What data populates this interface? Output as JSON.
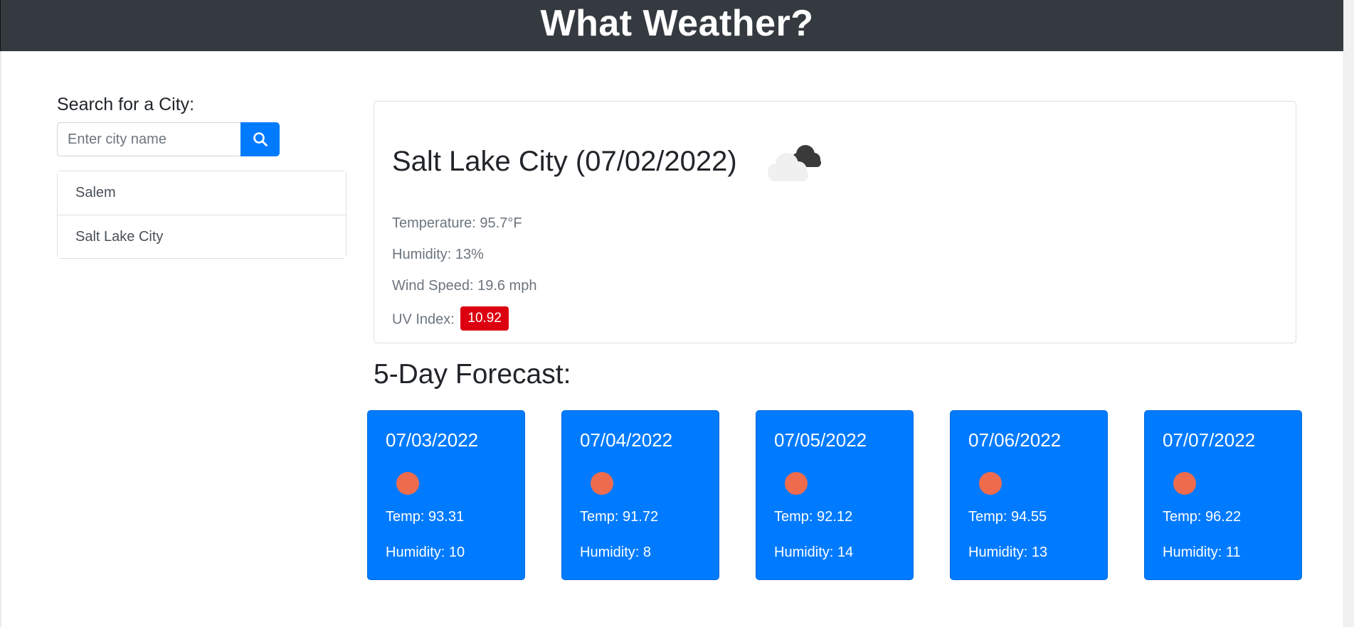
{
  "header": {
    "title": "What Weather?"
  },
  "search": {
    "label": "Search for a City:",
    "placeholder": "Enter city name",
    "value": ""
  },
  "history": [
    "Salem",
    "Salt Lake City"
  ],
  "current": {
    "title": "Salt Lake City (07/02/2022)",
    "icon": "partly-cloudy-icon",
    "temperature": "Temperature: 95.7°F",
    "humidity": "Humidity: 13%",
    "wind": "Wind Speed: 19.6 mph",
    "uv_label": "UV Index:",
    "uv_value": "10.92"
  },
  "forecast": {
    "title": "5-Day Forecast:",
    "days": [
      {
        "date": "07/03/2022",
        "icon": "sun-icon",
        "temp": "Temp: 93.31",
        "humidity": "Humidity: 10"
      },
      {
        "date": "07/04/2022",
        "icon": "sun-icon",
        "temp": "Temp: 91.72",
        "humidity": "Humidity: 8"
      },
      {
        "date": "07/05/2022",
        "icon": "sun-icon",
        "temp": "Temp: 92.12",
        "humidity": "Humidity: 14"
      },
      {
        "date": "07/06/2022",
        "icon": "sun-icon",
        "temp": "Temp: 94.55",
        "humidity": "Humidity: 13"
      },
      {
        "date": "07/07/2022",
        "icon": "sun-icon",
        "temp": "Temp: 96.22",
        "humidity": "Humidity: 11"
      }
    ]
  },
  "colors": {
    "header_bg": "#343a40",
    "primary": "#007bff",
    "uv_danger": "#dc0010",
    "sun": "#ee6c4d"
  }
}
